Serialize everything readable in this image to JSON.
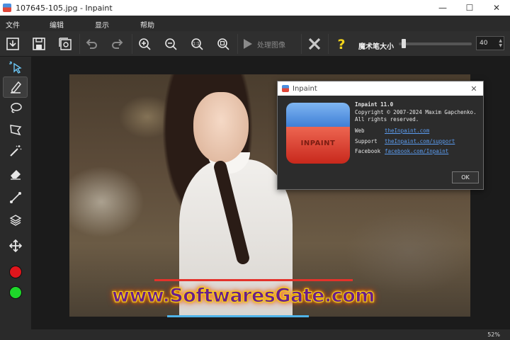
{
  "window": {
    "title": "107645-105.jpg - Inpaint",
    "minimize": "—",
    "maximize": "☐",
    "close": "✕"
  },
  "menu": {
    "items": [
      "文件",
      "编辑",
      "显示",
      "帮助"
    ]
  },
  "toolbar": {
    "process_label": "处理图像",
    "brush_size_label": "魔术笔大小",
    "brush_size_value": "40",
    "brush_size_fraction": 0.04
  },
  "tools": [
    "select-arrow-icon",
    "marker-icon",
    "lasso-icon",
    "polygon-lasso-icon",
    "magic-wand-icon",
    "eraser-icon",
    "line-icon",
    "layers-icon",
    "move-icon",
    "red-color",
    "green-color"
  ],
  "colors": {
    "red_swatch": "#e0151c",
    "green_swatch": "#1ed72a",
    "accent": "#f3d41b"
  },
  "canvas": {
    "watermark": "www.SoftwaresGate.com"
  },
  "about": {
    "title": "Inpaint",
    "logo_text": "INPAINT",
    "product": "Inpaint 11.0",
    "copyright": "Copyright © 2007-2024 Maxim Gapchenko.",
    "rights": "All rights reserved.",
    "web_label": "Web",
    "web_link": "theInpaint.com",
    "support_label": "Support",
    "support_link": "theInpaint.com/support",
    "facebook_label": "Facebook",
    "facebook_link": "facebook.com/Inpaint",
    "ok_label": "OK"
  },
  "status": {
    "zoom": "52%"
  }
}
